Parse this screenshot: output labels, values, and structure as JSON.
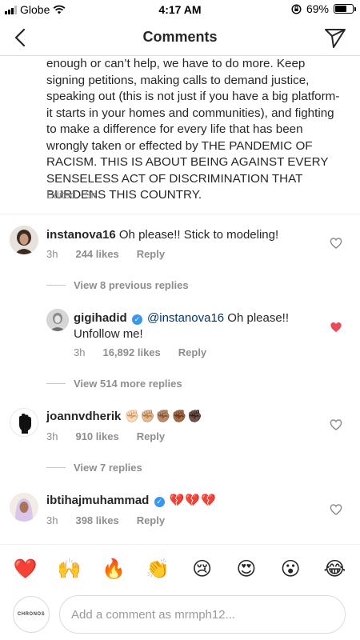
{
  "status_bar": {
    "carrier": "Globe",
    "time": "4:17 AM",
    "battery_percent": "69%",
    "battery_level": 0.69
  },
  "header": {
    "title": "Comments",
    "back_icon": "chevron-left-icon",
    "send_icon": "paper-plane-icon"
  },
  "caption": {
    "text": "enough or can’t help, we have to do more. Keep signing petitions, making calls to demand justice, speaking out (this is not just if you have a big platform- it starts in your homes and communities), and fighting to make a difference for every life that has been wrongly taken or effected by THE PANDEMIC OF RACISM. THIS IS ABOUT BEING AGAINST EVERY SENSELESS ACT OF DISCRIMINATION THAT BURDENS THIS COUNTRY.",
    "meta": "Edited · 3h"
  },
  "comments": [
    {
      "username": "instanova16",
      "text": "Oh please!! Stick to modeling!",
      "time": "3h",
      "likes": "244 likes",
      "reply": "Reply",
      "liked": false
    },
    {
      "view_previous": "View 8 previous replies"
    },
    {
      "username": "gigihadid",
      "verified": true,
      "mention": "@instanova16",
      "text": " Oh please!! Unfollow me!",
      "time": "3h",
      "likes": "16,892 likes",
      "reply": "Reply",
      "liked": true
    },
    {
      "view_more": "View 514 more replies"
    },
    {
      "username": "joannvdherik",
      "text": "✊🏻✊🏼✊🏽✊🏾✊🏿",
      "time": "3h",
      "likes": "910 likes",
      "reply": "Reply",
      "liked": false
    },
    {
      "view_replies": "View 7 replies"
    },
    {
      "username": "ibtihajmuhammad",
      "verified": true,
      "text": "💔💔💔",
      "time": "3h",
      "likes": "398 likes",
      "reply": "Reply",
      "liked": false
    }
  ],
  "emoji_bar": [
    "❤️",
    "🙌",
    "🔥",
    "👏",
    "😢",
    "😍",
    "😮",
    "😂"
  ],
  "comment_input": {
    "placeholder": "Add a comment as mrmph12...",
    "avatar_text": "CHRONOS"
  },
  "colors": {
    "like_red": "#ed4956",
    "verified_blue": "#3897f0",
    "mention_blue": "#00376b",
    "muted": "#8e8e8e"
  }
}
